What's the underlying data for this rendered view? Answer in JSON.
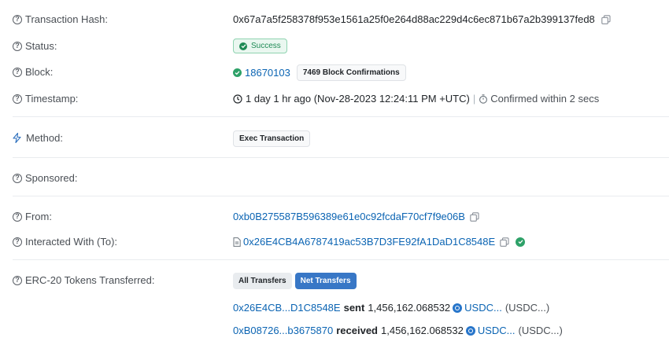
{
  "fields": {
    "tx_hash": {
      "label": "Transaction Hash:",
      "value": "0x67a7a5f258378f953e1561a25f0e264d88ac229d4c6ec871b67a2b399137fed8"
    },
    "status": {
      "label": "Status:",
      "value": "Success"
    },
    "block": {
      "label": "Block:",
      "number": "18670103",
      "confirmations": "7469 Block Confirmations"
    },
    "timestamp": {
      "label": "Timestamp:",
      "value": "1 day 1 hr ago (Nov-28-2023 12:24:11 PM +UTC)",
      "separator": "|",
      "confirmed": "Confirmed within 2 secs"
    },
    "method": {
      "label": "Method:",
      "value": "Exec Transaction"
    },
    "sponsored": {
      "label": "Sponsored:"
    },
    "from": {
      "label": "From:",
      "value": "0xb0B275587B596389e61e0c92fcdaF70cf7f9e06B"
    },
    "interacted": {
      "label": "Interacted With (To):",
      "value": "0x26E4CB4A6787419ac53B7D3FE92fA1DaD1C8548E"
    },
    "erc20": {
      "label": "ERC-20 Tokens Transferred:",
      "tabs": [
        "All Transfers",
        "Net Transfers"
      ],
      "transfers": [
        {
          "address": "0x26E4CB...D1C8548E",
          "action": "sent",
          "amount": "1,456,162.068532",
          "token": "USDC...",
          "token_full": "(USDC...)"
        },
        {
          "address": "0xB08726...b3675870",
          "action": "received",
          "amount": "1,456,162.068532",
          "token": "USDC...",
          "token_full": "(USDC...)"
        }
      ]
    }
  },
  "colors": {
    "link": "#0b64b3",
    "success": "#1e8a55",
    "net_transfers_bg": "#3877c6"
  }
}
